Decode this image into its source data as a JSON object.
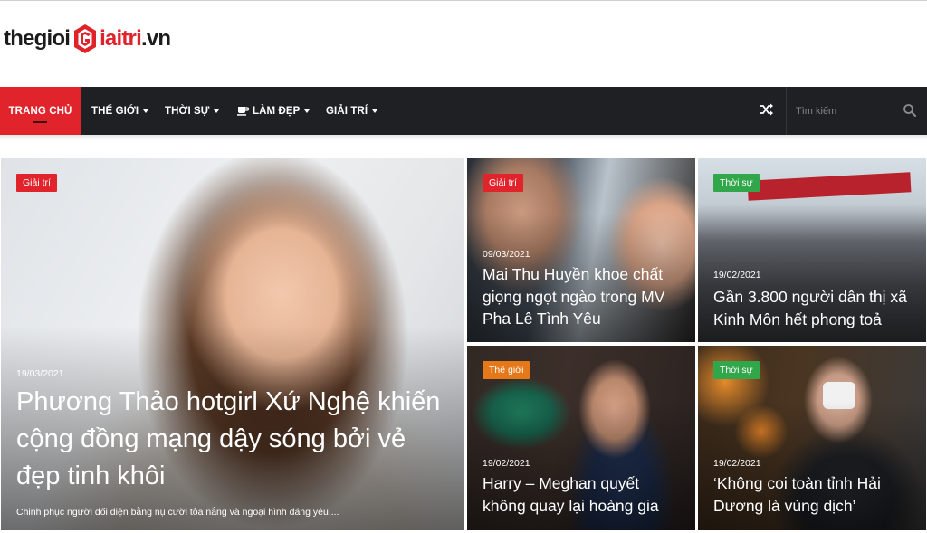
{
  "site": {
    "logo_part1": "thegioi",
    "logo_part2": "iaitri",
    "logo_part3": ".vn"
  },
  "nav": {
    "items": [
      {
        "label": "TRANG CHỦ",
        "active": true,
        "dropdown": false
      },
      {
        "label": "THẾ GIỚI",
        "active": false,
        "dropdown": true
      },
      {
        "label": "THỜI SỰ",
        "active": false,
        "dropdown": true
      },
      {
        "label": "LÀM ĐẸP",
        "active": false,
        "dropdown": true,
        "icon": "coffee-icon"
      },
      {
        "label": "GIẢI TRÍ",
        "active": false,
        "dropdown": true
      }
    ],
    "shuffle_icon": "shuffle-icon",
    "search_placeholder": "Tìm kiếm",
    "search_icon": "search-icon"
  },
  "colors": {
    "accent": "#e1232b",
    "nav_bg": "#1f2024",
    "badge_green": "#31a64a",
    "badge_orange": "#e57819"
  },
  "featured": {
    "category": "Giải trí",
    "date": "19/03/2021",
    "title": "Phương Thảo hotgirl Xứ Nghệ khiến cộng đồng mạng dậy sóng bởi vẻ đẹp tinh khôi",
    "excerpt": "Chinh phục người đối diện bằng nụ cười tỏa nắng và ngoại hình đáng yêu,..."
  },
  "posts": [
    {
      "category": "Giải trí",
      "date": "09/03/2021",
      "title": "Mai Thu Huyền khoe chất giọng ngọt ngào trong MV Pha Lê Tình Yêu"
    },
    {
      "category": "Thời sự",
      "date": "19/02/2021",
      "title": "Gần 3.800 người dân thị xã Kinh Môn hết phong toả"
    },
    {
      "category": "Thế giới",
      "date": "19/02/2021",
      "title": "Harry – Meghan quyết không quay lại hoàng gia"
    },
    {
      "category": "Thời sự",
      "date": "19/02/2021",
      "title": "‘Không coi toàn tỉnh Hải Dương là vùng dịch’"
    }
  ]
}
